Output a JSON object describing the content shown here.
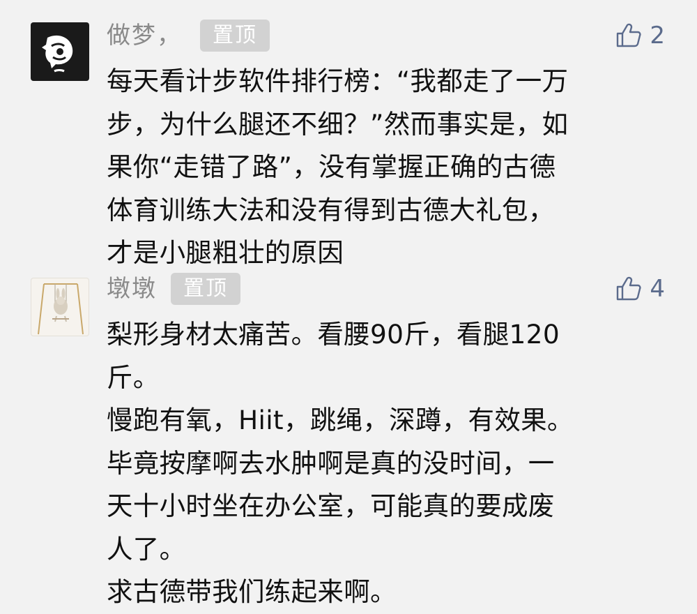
{
  "comments": [
    {
      "nickname": "做梦，",
      "badge": "置顶",
      "likes": "2",
      "lines": [
        "每天看计步软件排行榜：“我都走了一万",
        "步，为什么腿还不细？”然而事实是，如",
        "果你“走错了路”，没有掌握正确的古德",
        "体育训练大法和没有得到古德大礼包，",
        "才是小腿粗壮的原因"
      ]
    },
    {
      "nickname": "墩墩",
      "badge": "置顶",
      "likes": "4",
      "lines": [
        "梨形身材太痛苦。看腰90斤，看腿120",
        "斤。",
        "慢跑有氧，Hiit，跳绳，深蹲，有效果。",
        "毕竟按摩啊去水肿啊是真的没时间，一",
        "天十小时坐在办公室，可能真的要成废",
        "人了。",
        "求古德带我们练起来啊。"
      ]
    }
  ],
  "icons": {
    "like": "thumbs-up-icon",
    "avatar1": "face-silhouette-icon",
    "avatar2": "bunny-swing-icon"
  },
  "colors": {
    "background": "#f2f2f2",
    "nickname": "#8a8a8a",
    "badge_bg": "#d2d2d2",
    "like": "#5b6b8c",
    "text": "#111111"
  }
}
